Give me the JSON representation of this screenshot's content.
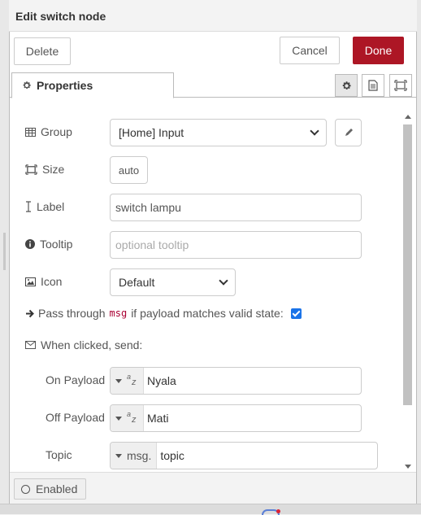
{
  "header": {
    "title": "Edit switch node"
  },
  "toolbar": {
    "delete_label": "Delete",
    "cancel_label": "Cancel",
    "done_label": "Done"
  },
  "tabs": {
    "properties_label": "Properties"
  },
  "form": {
    "group": {
      "label": "Group",
      "value": "[Home] Input"
    },
    "size": {
      "label": "Size",
      "value": "auto"
    },
    "label": {
      "label": "Label",
      "value": "switch lampu"
    },
    "tooltip": {
      "label": "Tooltip",
      "placeholder": "optional tooltip"
    },
    "icon": {
      "label": "Icon",
      "value": "Default"
    },
    "passthrough": {
      "text_before": "Pass through",
      "code": "msg",
      "text_after": "if payload matches valid state:",
      "checked": true
    },
    "when_clicked": {
      "label": "When clicked, send:"
    },
    "on_payload": {
      "label": "On Payload",
      "type": "string",
      "value": "Nyala"
    },
    "off_payload": {
      "label": "Off Payload",
      "type": "string",
      "value": "Mati"
    },
    "topic": {
      "label": "Topic",
      "type_label": "msg.",
      "value": "topic"
    }
  },
  "footer": {
    "enabled_label": "Enabled"
  },
  "colors": {
    "done_bg": "#ad1625",
    "checkbox": "#1a73e8",
    "code": "#aa0033"
  },
  "icons": {
    "settings_tab": "gear-icon",
    "description_tab": "document-icon",
    "appearance_tab": "frame-icon",
    "group": "table-icon",
    "size": "frame-icon",
    "label": "text-cursor-icon",
    "tooltip": "info-circle-icon",
    "icon": "image-icon",
    "passthrough": "arrow-right-icon",
    "when_clicked": "envelope-icon",
    "edit": "pencil-icon"
  }
}
